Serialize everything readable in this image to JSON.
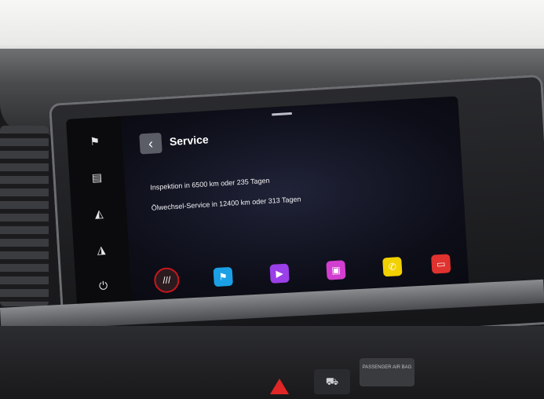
{
  "screen": {
    "title": "Service",
    "back_icon": "chevron-left",
    "lines": [
      "Inspektion in 6500 km oder 235 Tagen",
      "Ölwechsel-Service in 12400 km oder 313 Tagen"
    ]
  },
  "side_rail": {
    "icons": [
      "flag-icon",
      "seat-heat-icon",
      "brightness-up-icon",
      "brightness-down-icon",
      "power-icon"
    ]
  },
  "dock": {
    "apps": [
      {
        "name": "seat-logo-app",
        "color": "#c8161d"
      },
      {
        "name": "navigation-app",
        "color": "#1ba0e6"
      },
      {
        "name": "media-app",
        "color": "#9b3fe8"
      },
      {
        "name": "radio-app",
        "color": "#d23ecf"
      },
      {
        "name": "phone-app",
        "color": "#f2d100"
      },
      {
        "name": "app-connect",
        "color": "#e0322e"
      }
    ]
  },
  "dashboard": {
    "airbag_text": "PASSENGER AIR BAG",
    "hazard_color": "#e02626"
  }
}
